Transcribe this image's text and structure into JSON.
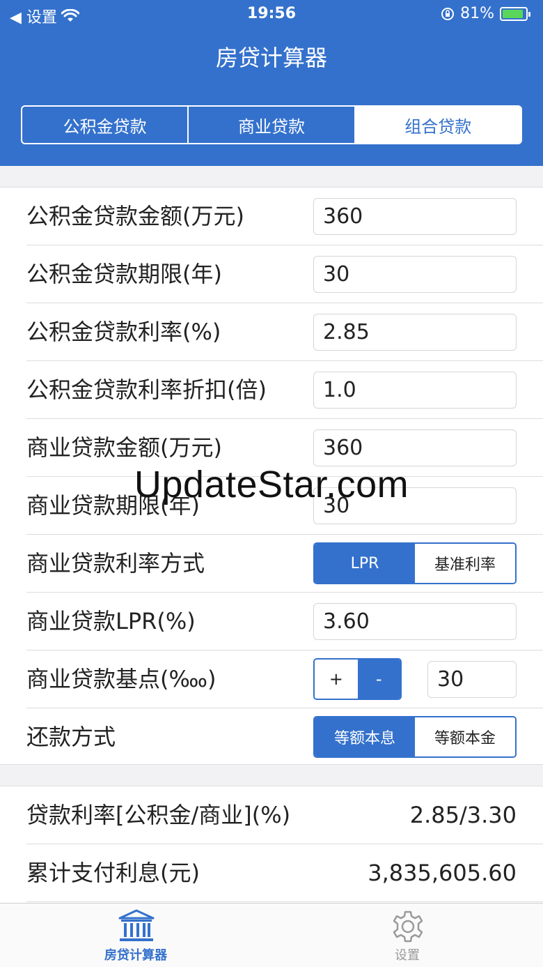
{
  "status_bar": {
    "back_label": "◀ 设置",
    "time": "19:56",
    "battery": "81%"
  },
  "header": {
    "title": "房贷计算器",
    "tabs": [
      {
        "label": "公积金贷款",
        "active": false
      },
      {
        "label": "商业贷款",
        "active": false
      },
      {
        "label": "组合贷款",
        "active": true
      }
    ]
  },
  "form": {
    "pf_amount": {
      "label": "公积金贷款金额(万元)",
      "value": "360"
    },
    "pf_term": {
      "label": "公积金贷款期限(年)",
      "value": "30"
    },
    "pf_rate": {
      "label": "公积金贷款利率(%)",
      "value": "2.85"
    },
    "pf_discount": {
      "label": "公积金贷款利率折扣(倍)",
      "value": "1.0"
    },
    "com_amount": {
      "label": "商业贷款金额(万元)",
      "value": "360"
    },
    "com_term": {
      "label": "商业贷款期限(年)",
      "value": "30"
    },
    "com_rate_mode": {
      "label": "商业贷款利率方式",
      "options": [
        "LPR",
        "基准利率"
      ],
      "selected": "LPR"
    },
    "com_lpr": {
      "label": "商业贷款LPR(%)",
      "value": "3.60"
    },
    "com_bp": {
      "label": "商业贷款基点(‱)",
      "plus": "+",
      "minus": "-",
      "value": "30"
    },
    "repay_mode": {
      "label": "还款方式",
      "options": [
        "等额本息",
        "等额本金"
      ],
      "selected": "等额本息"
    }
  },
  "results": {
    "rate": {
      "label": "贷款利率[公积金/商业](%)",
      "value": "2.85/3.30"
    },
    "interest": {
      "label": "累计支付利息(元)",
      "value": "3,835,605.60"
    }
  },
  "tabbar": {
    "calculator": "房贷计算器",
    "settings": "设置"
  },
  "watermark": "UpdateStar.com",
  "colors": {
    "accent": "#3471cc",
    "background": "#f2f2f4"
  }
}
